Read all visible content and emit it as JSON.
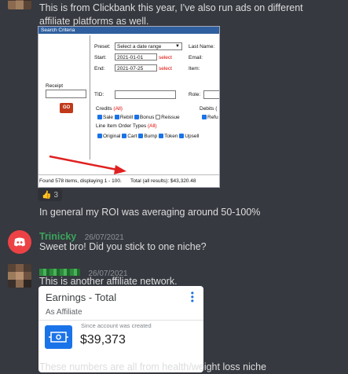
{
  "message1": {
    "text": "This is from Clickbank this year, I've also run ads on different affiliate platforms as well.",
    "screenshot": {
      "header": "Search Criteria",
      "preset_label": "Preset:",
      "preset_value": "Select a date range",
      "start_label": "Start:",
      "start_value": "2021-01-01",
      "end_label": "End:",
      "end_value": "2021-07-25",
      "select_link": "select",
      "last_name_label": "Last Name:",
      "email_label": "Email:",
      "item_label": "Item:",
      "receipt_label": "Receipt",
      "go_button": "GO",
      "tid_label": "TID:",
      "role_label": "Role:",
      "credits_label": "Credits",
      "all_link": "(All)",
      "debits_label": "Debits (",
      "credit_options": [
        "Sale",
        "Rebill",
        "Bonus",
        "Reissue"
      ],
      "refund_label": "Refu",
      "line_item_label": "Line Item Order Types",
      "order_types": [
        "Original",
        "Cart",
        "Bump",
        "Token",
        "Upsell"
      ],
      "found_text": "Found 578 items, displaying 1 - 100.",
      "total_text": "Total (all results): $43,320.48",
      "arrow_color": "#e02020"
    },
    "reaction": {
      "emoji": "👍",
      "count": "3"
    },
    "followup": "In general my ROI was averaging around 50-100%"
  },
  "message2": {
    "username": "Trinicky",
    "timestamp": "26/07/2021",
    "text": "Sweet bro!  Did you stick to one niche?",
    "name_color": "#3ba55d"
  },
  "message3": {
    "timestamp": "26/07/2021",
    "text": "This is another affiliate network.",
    "card": {
      "title": "Earnings - Total",
      "subtitle": "As Affiliate",
      "since_label": "Since account was created",
      "amount": "$39,373"
    },
    "partial_text": "These numbers are all from health/weight loss niche"
  },
  "colors": {
    "background": "#36393f",
    "text": "#dcddde",
    "timestamp": "#8e9297",
    "discord_red": "#ed4245",
    "card_blue": "#1a73e8"
  }
}
